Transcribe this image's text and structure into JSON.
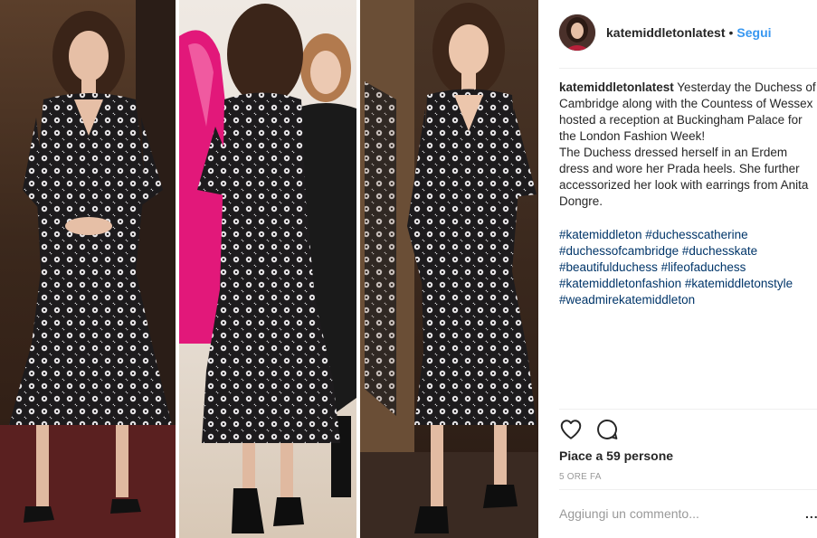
{
  "post": {
    "username": "katemiddletonlatest",
    "dot": "•",
    "follow_label": "Segui",
    "caption_username": "katemiddletonlatest",
    "caption_line1": "Yesterday the Duchess of Cambridge along with the Countess of Wessex hosted a reception at Buckingham Palace for the London Fashion Week!",
    "caption_line2": "The Duchess dressed herself in an Erdem dress and wore her Prada heels. She further accessorized her look with earrings from Anita Dongre.",
    "hashtags": [
      "#katemiddleton #duchesscatherine",
      "#duchessofcambridge #duchesskate",
      "#beautifulduchess #lifeofaduchess",
      "#katemiddletonfashion #katemiddletonstyle",
      "#weadmirekatemiddleton"
    ],
    "likes": "Piace a 59 persone",
    "time": "5 ORE FA",
    "comment_placeholder": "Aggiungi un commento...",
    "more": "..."
  },
  "icons": [
    "heart-icon",
    "comment-icon",
    "more-options-icon"
  ],
  "colors": {
    "link": "#3897f0",
    "hashtag": "#003569",
    "muted": "#999999",
    "text": "#262626"
  }
}
